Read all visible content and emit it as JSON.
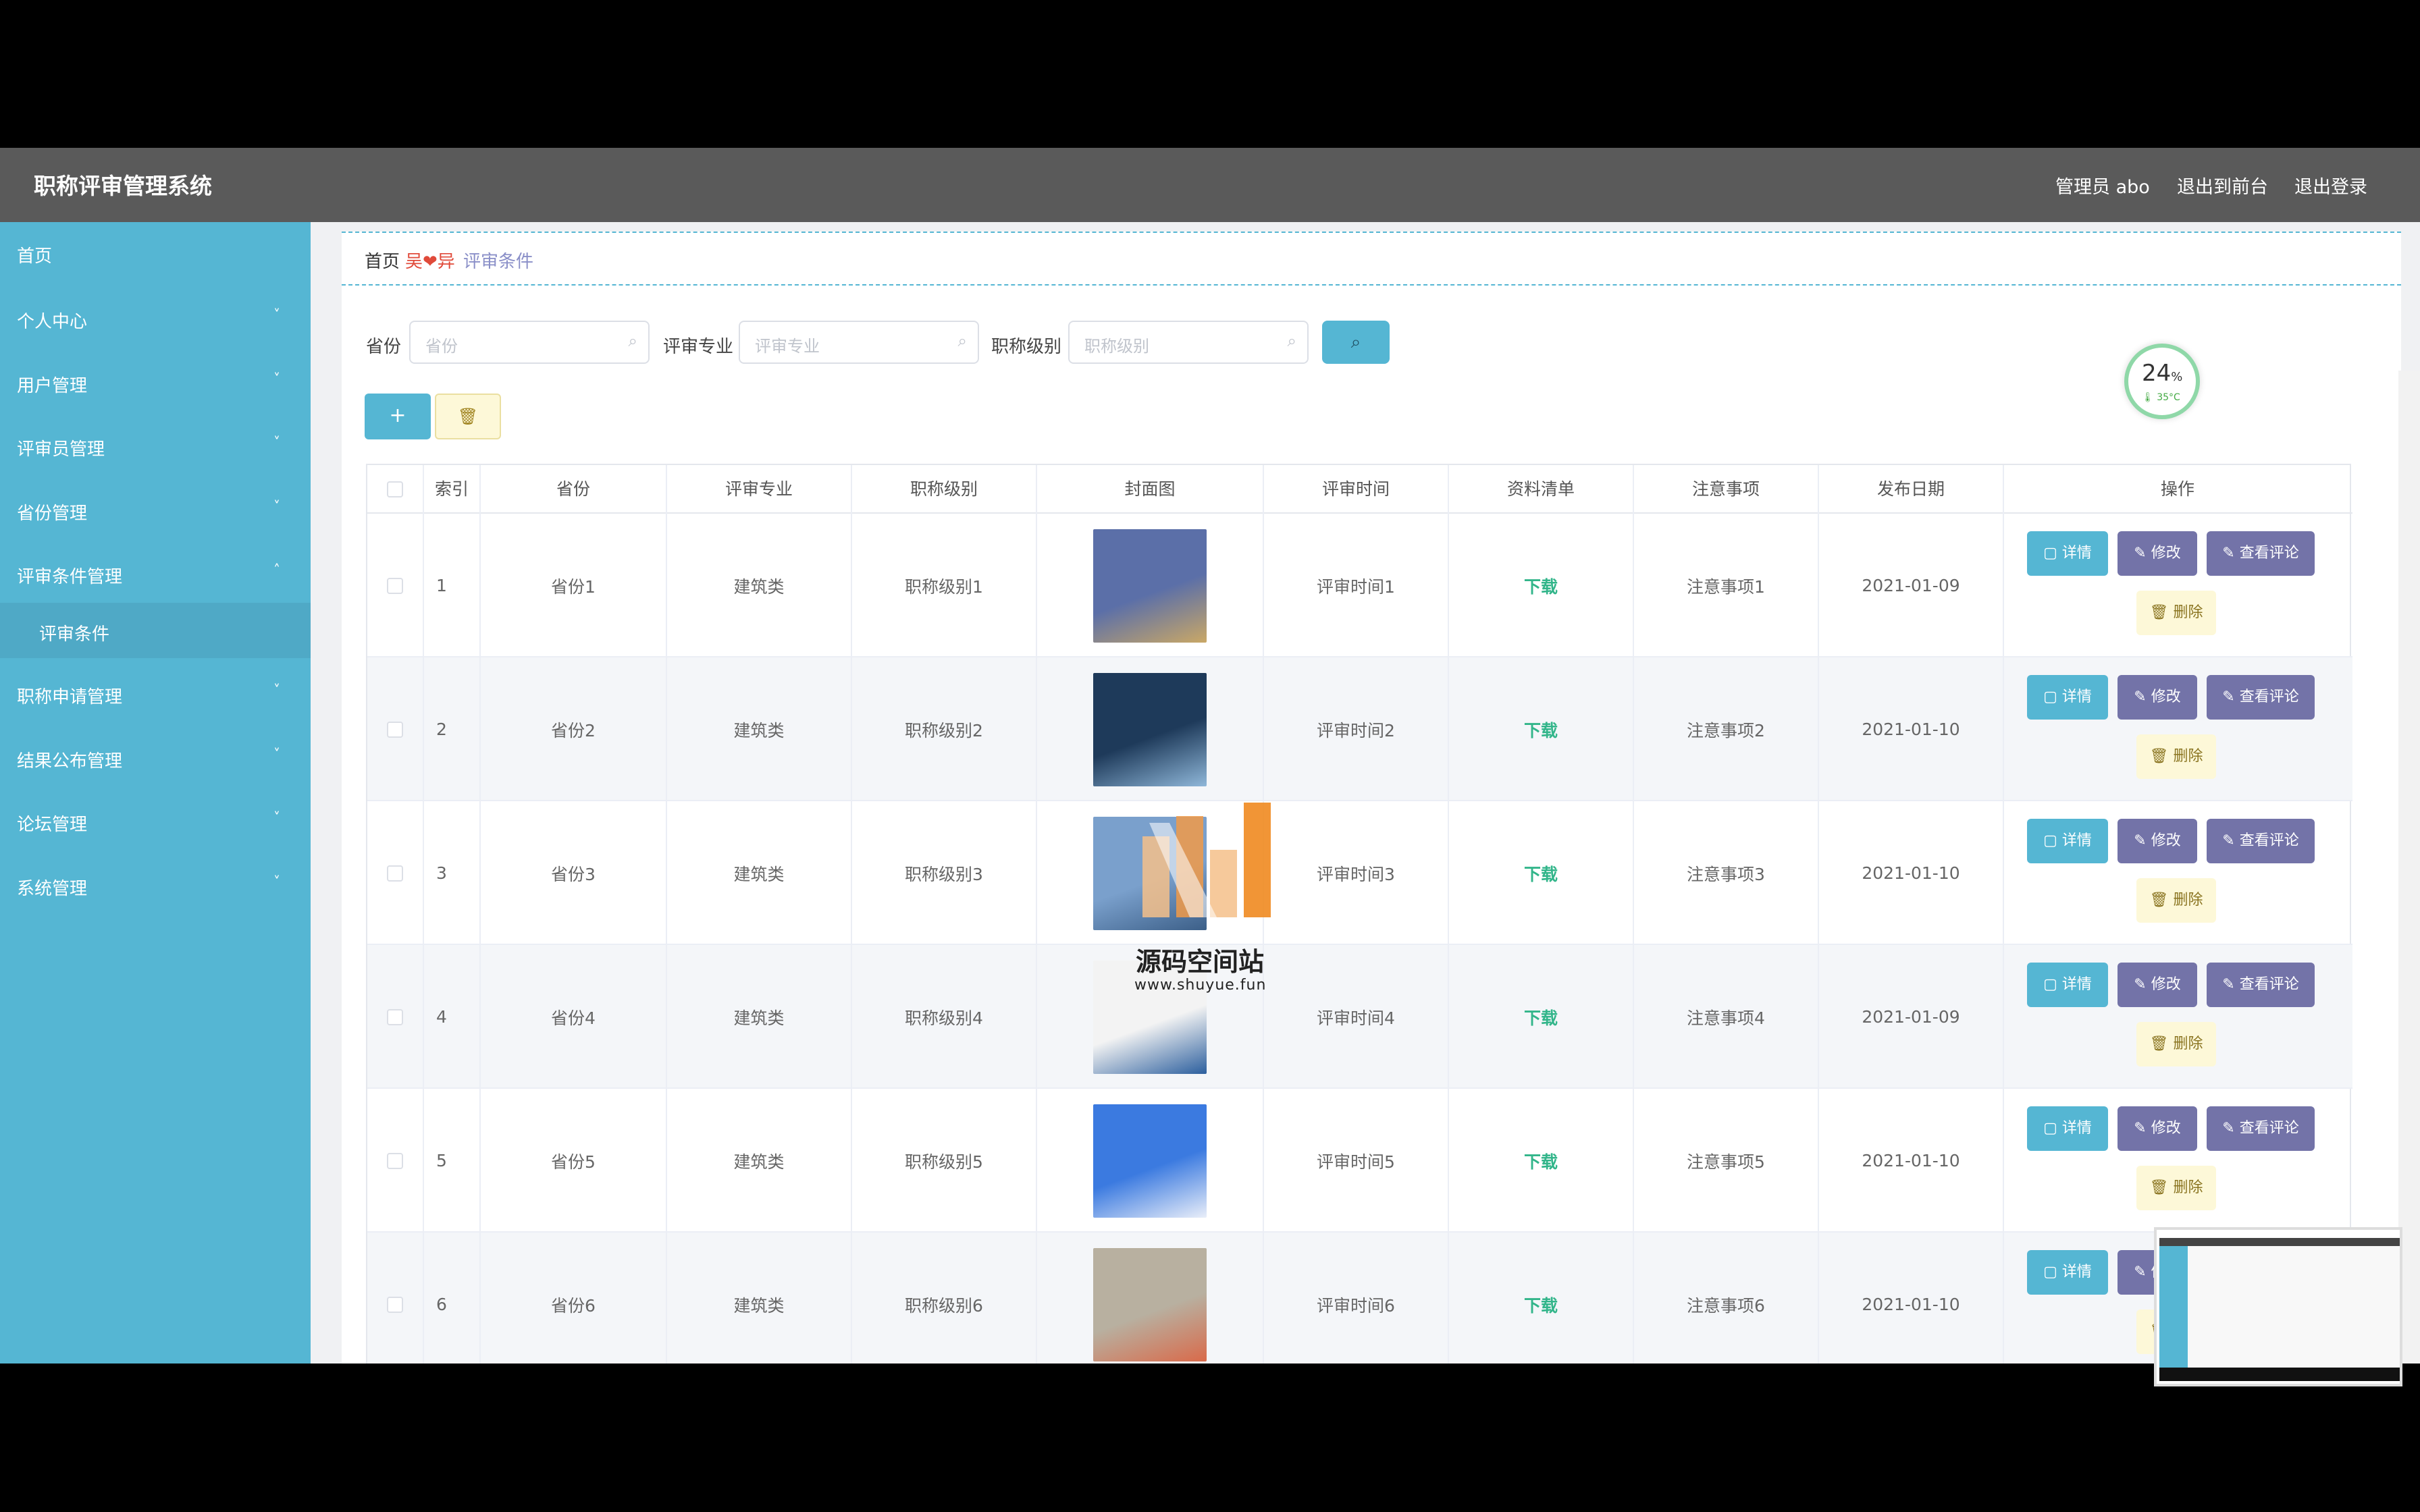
{
  "header": {
    "title": "职称评审管理系统",
    "user": "管理员 abo",
    "to_front": "退出到前台",
    "logout": "退出登录"
  },
  "sidebar": {
    "items": [
      {
        "label": "首页",
        "expandable": false
      },
      {
        "label": "个人中心",
        "expandable": true
      },
      {
        "label": "用户管理",
        "expandable": true
      },
      {
        "label": "评审员管理",
        "expandable": true
      },
      {
        "label": "省份管理",
        "expandable": true
      },
      {
        "label": "评审条件管理",
        "expandable": true,
        "expanded": true
      },
      {
        "label": "职称申请管理",
        "expandable": true
      },
      {
        "label": "结果公布管理",
        "expandable": true
      },
      {
        "label": "论坛管理",
        "expandable": true
      },
      {
        "label": "系统管理",
        "expandable": true
      }
    ],
    "sub_item": "评审条件",
    "chevron_down": "˅",
    "chevron_up": "˄"
  },
  "breadcrumb": {
    "home": "首页",
    "separator": "吴❤异",
    "current": "评审条件"
  },
  "search": {
    "province_label": "省份",
    "province_placeholder": "省份",
    "major_label": "评审专业",
    "major_placeholder": "评审专业",
    "level_label": "职称级别",
    "level_placeholder": "职称级别",
    "search_icon": "⌕"
  },
  "actions": {
    "add_icon": "+",
    "delete_icon": "🗑"
  },
  "table": {
    "columns": [
      "索引",
      "省份",
      "评审专业",
      "职称级别",
      "封面图",
      "评审时间",
      "资料清单",
      "注意事项",
      "发布日期",
      "操作"
    ],
    "rows": [
      {
        "index": "1",
        "province": "省份1",
        "major": "建筑类",
        "level": "职称级别1",
        "time": "评审时间1",
        "list": "下载",
        "notes": "注意事项1",
        "date": "2021-01-09"
      },
      {
        "index": "2",
        "province": "省份2",
        "major": "建筑类",
        "level": "职称级别2",
        "time": "评审时间2",
        "list": "下载",
        "notes": "注意事项2",
        "date": "2021-01-10"
      },
      {
        "index": "3",
        "province": "省份3",
        "major": "建筑类",
        "level": "职称级别3",
        "time": "评审时间3",
        "list": "下载",
        "notes": "注意事项3",
        "date": "2021-01-10"
      },
      {
        "index": "4",
        "province": "省份4",
        "major": "建筑类",
        "level": "职称级别4",
        "time": "评审时间4",
        "list": "下载",
        "notes": "注意事项4",
        "date": "2021-01-09"
      },
      {
        "index": "5",
        "province": "省份5",
        "major": "建筑类",
        "level": "职称级别5",
        "time": "评审时间5",
        "list": "下载",
        "notes": "注意事项5",
        "date": "2021-01-10"
      },
      {
        "index": "6",
        "province": "省份6",
        "major": "建筑类",
        "level": "职称级别6",
        "time": "评审时间6",
        "list": "下载",
        "notes": "注意事项6",
        "date": "2021-01-10"
      }
    ],
    "ops": {
      "detail": "▢ 详情",
      "edit": "✎ 修改",
      "comments": "✎ 查看评论",
      "delete": "🗑 删除"
    }
  },
  "overlay": {
    "badge_value": "24",
    "badge_unit": "%",
    "badge_temp": "🌡 35°C",
    "watermark_name": "源码空间站",
    "watermark_url": "www.shuyue.fun"
  },
  "colors": {
    "sidebar": "#55b6d3",
    "header": "#5a5a5a",
    "edit": "#7373a8",
    "download": "#32b58a"
  }
}
